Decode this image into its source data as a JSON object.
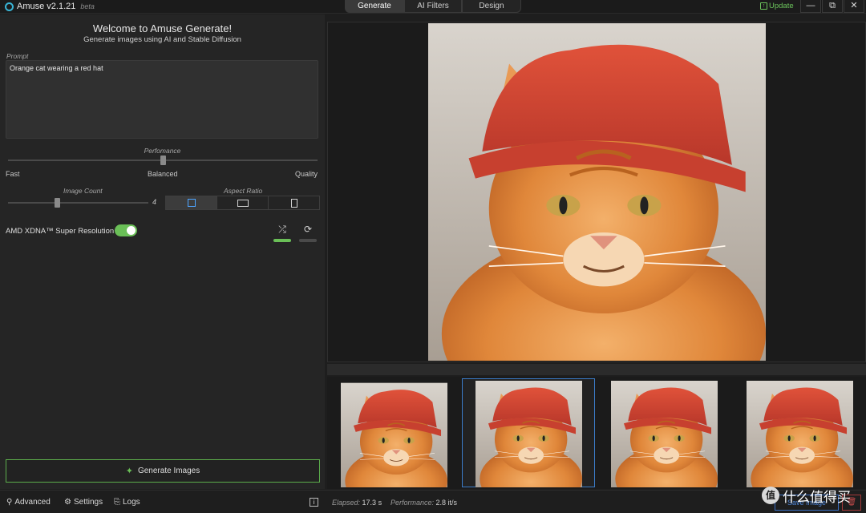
{
  "app": {
    "title": "Amuse v2.1.21",
    "beta": "beta",
    "tabs": [
      {
        "label": "Generate",
        "active": true
      },
      {
        "label": "AI Filters",
        "active": false
      },
      {
        "label": "Design",
        "active": false
      }
    ],
    "update_label": "Update",
    "window_controls": {
      "minimize": "—",
      "maximize": "⧉",
      "close": "✕"
    }
  },
  "left_panel": {
    "welcome": "Welcome to Amuse Generate!",
    "subtitle": "Generate images using AI and Stable Diffusion",
    "prompt_label": "Prompt",
    "prompt_value": "Orange cat wearing a red hat",
    "performance": {
      "label": "Perfomance",
      "min_label": "Fast",
      "mid_label": "Balanced",
      "max_label": "Quality",
      "value": 0.5
    },
    "image_count": {
      "label": "Image Count",
      "value": "4",
      "fraction": 0.35
    },
    "aspect_ratio": {
      "label": "Aspect Ratio",
      "options": [
        "square",
        "landscape",
        "portrait"
      ],
      "selected": "square"
    },
    "super_resolution": {
      "label": "AMD XDNA™ Super Resolution",
      "enabled": true
    },
    "shuffle_icon": "shuffle-icon",
    "refresh_icon": "refresh-icon",
    "generate_label": "Generate Images"
  },
  "bottom_bar": {
    "advanced": "Advanced",
    "settings": "Settings",
    "logs": "Logs",
    "elapsed_label": "Elapsed:",
    "elapsed_value": "17.3 s",
    "performance_label": "Performance:",
    "performance_value": "2.8 it/s",
    "save_label": "Save Image",
    "watermark": "什么值得买"
  },
  "colors": {
    "accent_green": "#6abf57",
    "accent_blue": "#4ea4ff",
    "hat_red": "#d2452f",
    "cat_orange": "#e0873a",
    "background": "#1e1e1e"
  },
  "gallery": {
    "count": 4,
    "selected_index": 1
  }
}
